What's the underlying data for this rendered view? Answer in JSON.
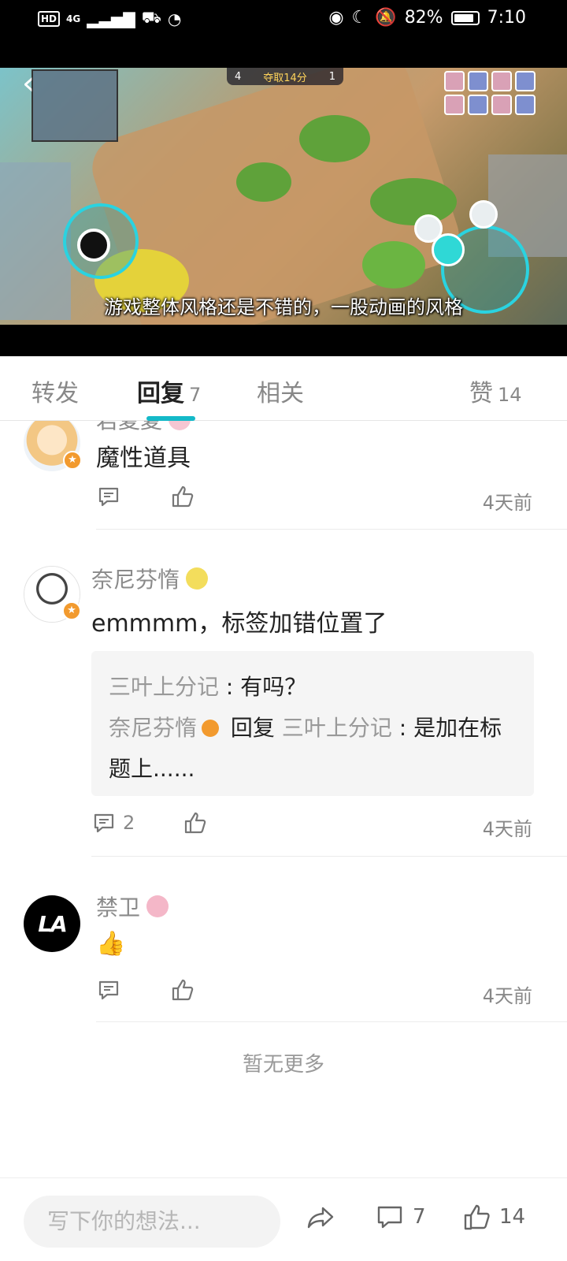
{
  "status_bar": {
    "chips": [
      "HD"
    ],
    "network": "4G",
    "battery": "82%",
    "time": "7:10"
  },
  "video": {
    "subtitle": "游戏整体风格还是不错的，一股动画的风格",
    "score_left": "4",
    "score_title": "夺取14分",
    "score_right": "1"
  },
  "tabs": {
    "forward": "转发",
    "reply": "回复",
    "reply_count": "7",
    "related": "相关",
    "likes_label": "赞",
    "likes_count": "14"
  },
  "comments": [
    {
      "username": "君夏夏",
      "content": "魔性道具",
      "time": "4天前",
      "reply_count": "",
      "avatar_color": "#f6d6a8"
    },
    {
      "username": "奈尼芬惰",
      "content": "emmmm，标签加错位置了",
      "time": "4天前",
      "reply_count": "2",
      "avatar_color": "#f2f2f2",
      "quotes": {
        "q1_name": "三叶上分记",
        "q1_sep": " : ",
        "q1_text": "有吗？",
        "q2_name": "奈尼芬惰",
        "q2_reply": "回复",
        "q2_target": "三叶上分记",
        "q2_sep": " : ",
        "q2_text": "是加在标题上......"
      }
    },
    {
      "username": "禁卫",
      "content": "👍",
      "time": "4天前",
      "reply_count": "",
      "avatar_color": "#000000"
    }
  ],
  "no_more": "暂无更多",
  "bottom_bar": {
    "placeholder": "写下你的想法...",
    "comment_count": "7",
    "like_count": "14"
  },
  "colors": {
    "accent": "#14b9c8",
    "badge": "#f29a2e"
  }
}
